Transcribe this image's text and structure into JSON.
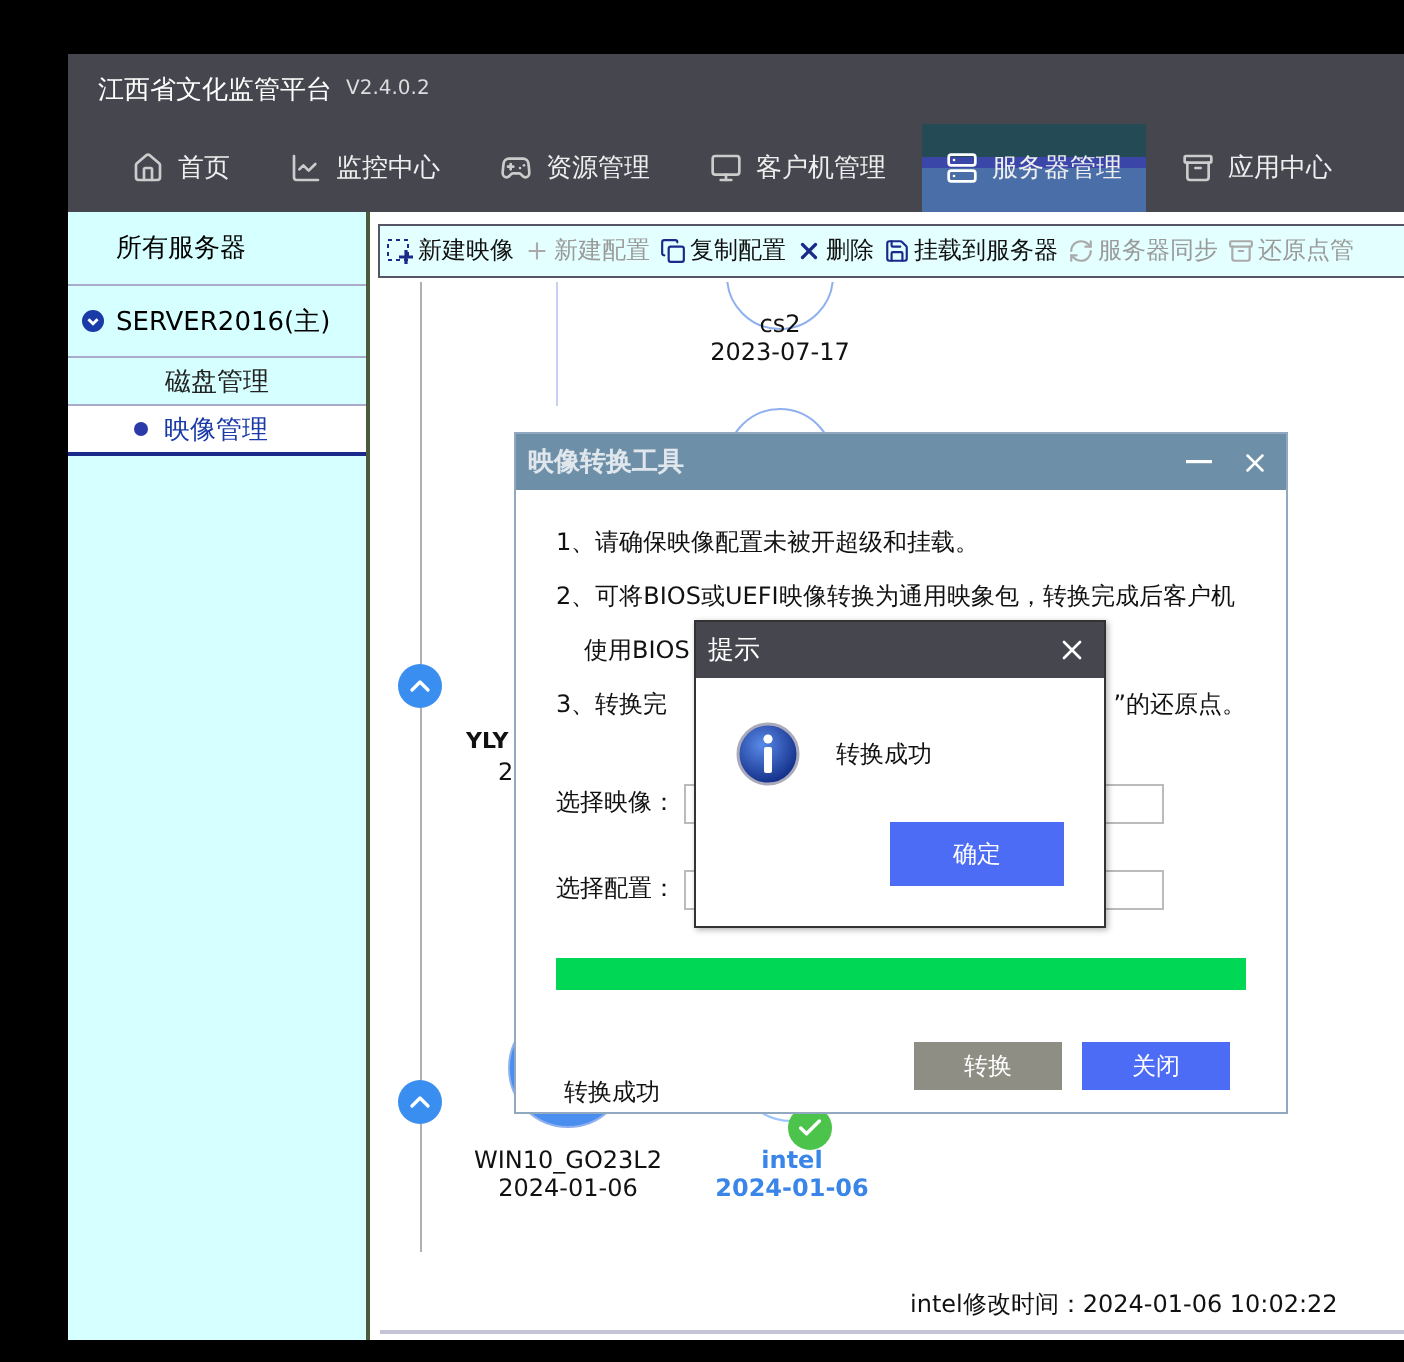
{
  "app": {
    "title": "江西省文化监管平台",
    "version": "V2.4.0.2"
  },
  "nav": [
    {
      "label": "首页",
      "selected": false
    },
    {
      "label": "监控中心",
      "selected": false
    },
    {
      "label": "资源管理",
      "selected": false
    },
    {
      "label": "客户机管理",
      "selected": false
    },
    {
      "label": "服务器管理",
      "selected": true
    },
    {
      "label": "应用中心",
      "selected": false
    }
  ],
  "sidebar": {
    "header": "所有服务器",
    "server": {
      "label": "SERVER2016(主)",
      "expanded": true
    },
    "items": [
      {
        "label": "磁盘管理",
        "selected": false,
        "kind": "group"
      },
      {
        "label": "映像管理",
        "selected": true,
        "kind": "leaf"
      }
    ]
  },
  "toolbar": [
    {
      "label": "新建映像",
      "disabled": false
    },
    {
      "label": "新建配置",
      "disabled": true
    },
    {
      "label": "复制配置",
      "disabled": false
    },
    {
      "label": "删除",
      "disabled": false
    },
    {
      "label": "挂载到服务器",
      "disabled": false
    },
    {
      "label": "服务器同步",
      "disabled": true
    },
    {
      "label": "还原点管",
      "disabled": true
    }
  ],
  "timeline": [
    {
      "name": "cs2",
      "date": "2023-07-17",
      "selected": false
    },
    {
      "name": "YLY",
      "date": "2",
      "selected": false
    },
    {
      "name": "WIN10_GO23L2",
      "date": "2024-01-06",
      "selected": false
    },
    {
      "name": "intel",
      "date": "2024-01-06",
      "selected": true
    }
  ],
  "footer_text": "intel修改时间：2024-01-06 10:02:22",
  "convert_dialog": {
    "title": "映像转换工具",
    "lines": [
      {
        "kind": "line",
        "left": "1、请确保映像配置未被开超级和挂载。"
      },
      {
        "kind": "line",
        "left": "2、可将BIOS或UEFI映像转换为通用映象包，转换完成后客户机"
      },
      {
        "kind": "continuation",
        "left": "使用BIOS"
      },
      {
        "kind": "line",
        "left": "3、转换完",
        "right": "”的还原点。"
      }
    ],
    "fields": [
      {
        "label": "选择映像："
      },
      {
        "label": "选择配置："
      }
    ],
    "progress": {
      "level": 1
    },
    "status": "转换成功",
    "buttons": [
      {
        "label": "转换",
        "disabled": true
      },
      {
        "label": "关闭",
        "disabled": false
      }
    ]
  },
  "alert": {
    "title": "提示",
    "message": "转换成功",
    "button": "确定"
  }
}
